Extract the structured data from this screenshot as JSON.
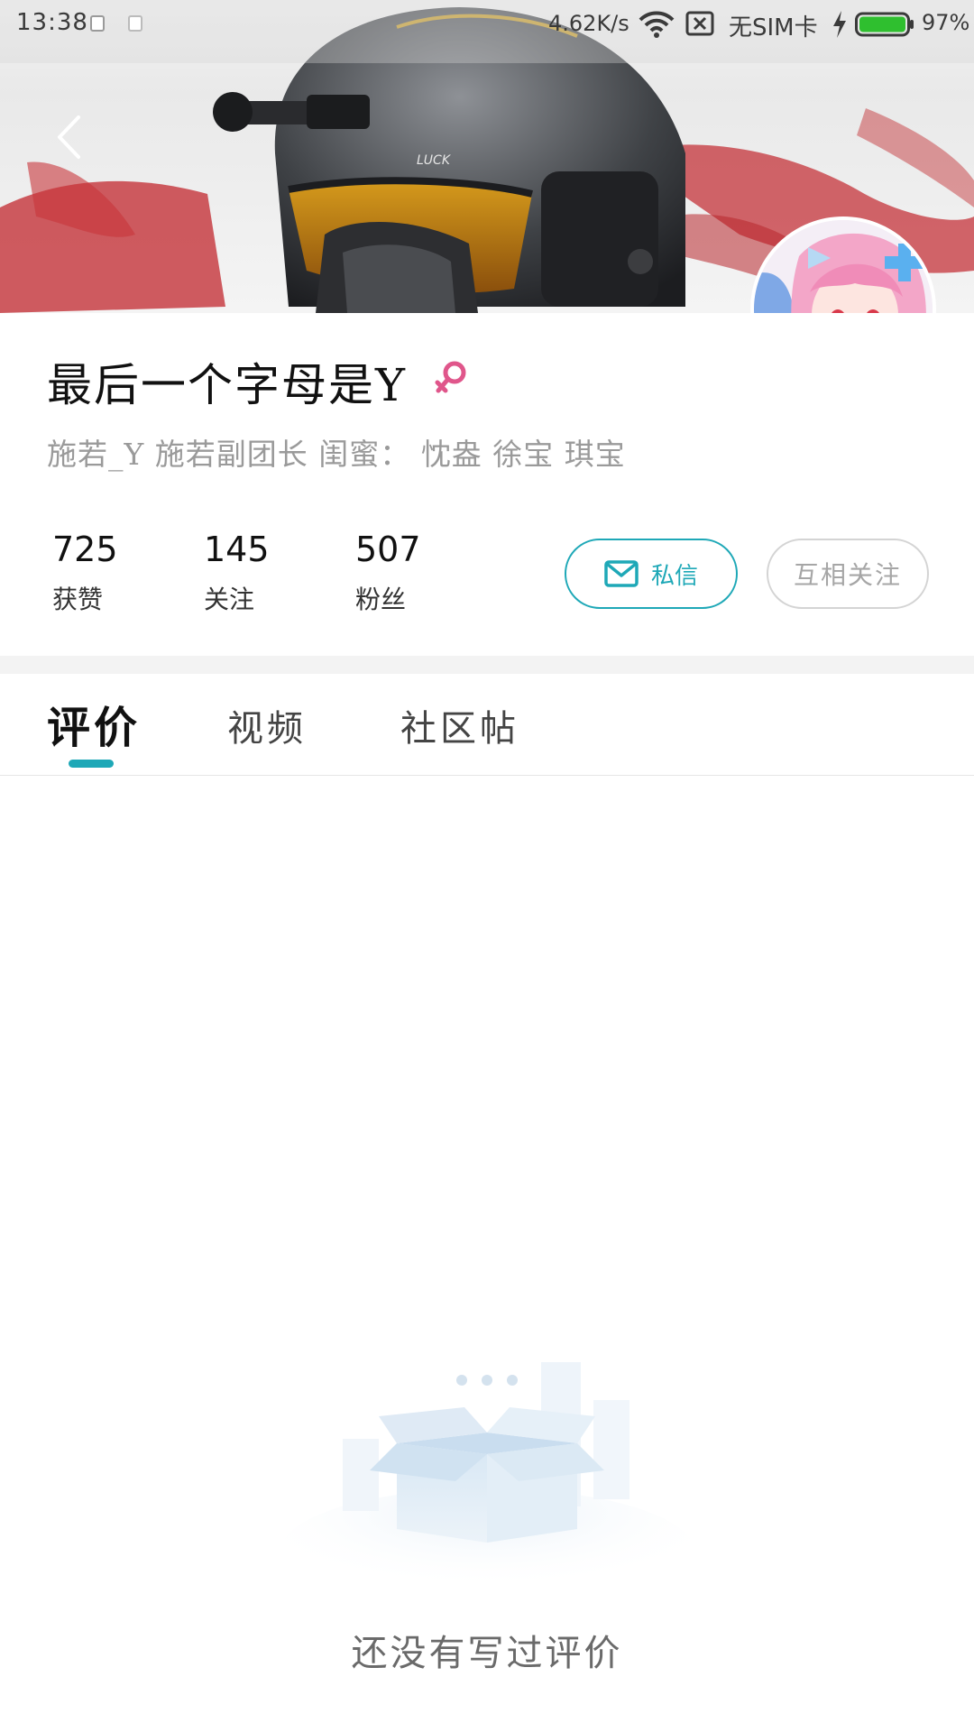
{
  "status_bar": {
    "time": "13:38",
    "network_speed": "4.62K/s",
    "sim_status": "无SIM卡",
    "battery": "97%"
  },
  "profile": {
    "username": "最后一个字母是Y",
    "gender": "female",
    "bio": "施若_Y 施若副团长  闺蜜：  忱盎 徐宝 琪宝",
    "stats": [
      {
        "value": "725",
        "label": "获赞"
      },
      {
        "value": "145",
        "label": "关注"
      },
      {
        "value": "507",
        "label": "粉丝"
      }
    ],
    "message_button": "私信",
    "follow_button": "互相关注"
  },
  "tabs": [
    "评价",
    "视频",
    "社区帖"
  ],
  "active_tab": "评价",
  "empty_state": {
    "text": "还没有写过评价"
  },
  "colors": {
    "accent": "#1ea8b7",
    "gender_female": "#e0568b",
    "banner_red": "#c2272d"
  },
  "icons": {
    "back": "back-chevron-icon",
    "message": "mail-icon",
    "gender": "female-icon",
    "empty": "empty-box-icon"
  }
}
